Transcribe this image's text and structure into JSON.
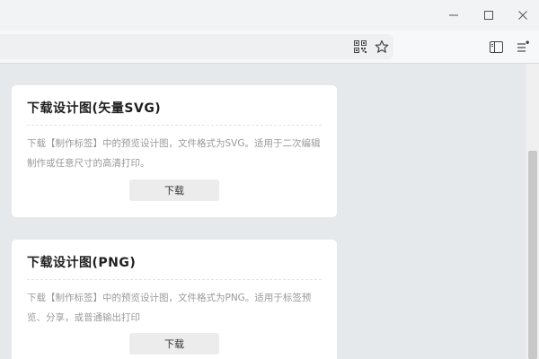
{
  "cards": [
    {
      "title": "下载设计图(矢量SVG)",
      "description": "下载【制作标签】中的预览设计图，文件格式为SVG。适用于二次编辑制作或任意尺寸的高清打印。",
      "button_label": "下载"
    },
    {
      "title": "下载设计图(PNG)",
      "description": "下载【制作标签】中的预览设计图，文件格式为PNG。适用于标签预览、分享，或普通输出打印",
      "button_label": "下载"
    }
  ],
  "icons": {
    "minimize": "minimize-icon",
    "maximize": "maximize-icon",
    "close": "close-icon",
    "qr": "qr-code-icon",
    "favorite": "star-icon",
    "sidebar": "sidebar-icon",
    "menu": "menu-icon"
  }
}
